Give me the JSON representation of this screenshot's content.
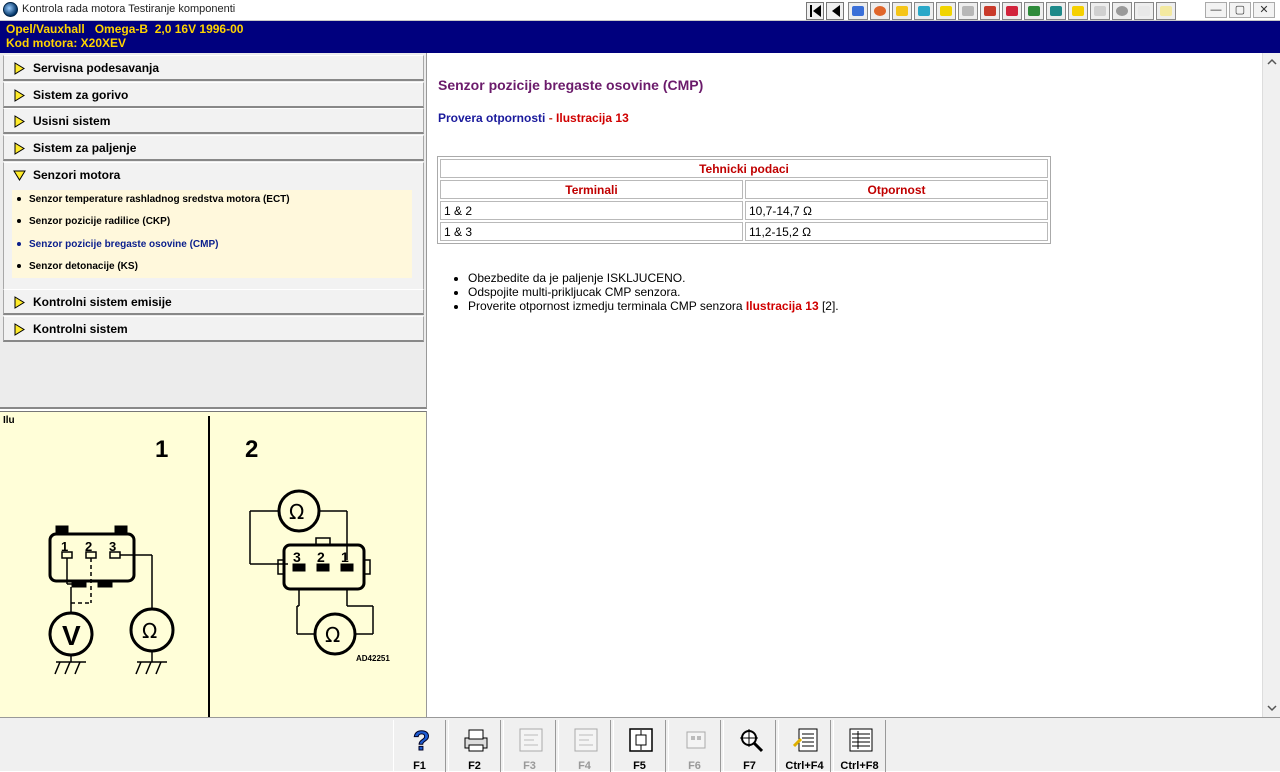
{
  "window": {
    "title": "Kontrola rada motora Testiranje komponenti"
  },
  "window_controls": {
    "minimize": "—",
    "maximize": "▢",
    "close": "✕"
  },
  "toolbar_icons": [
    "graph-icon",
    "globe-icon",
    "wrench-icon",
    "gauge-icon",
    "list-icon",
    "document-icon",
    "car-icon",
    "cards-icon",
    "chip-icon",
    "tools-icon",
    "gear-icon",
    "warning-icon",
    "stop-icon",
    "book-icon"
  ],
  "vehicle": {
    "line1": "Opel/Vauxhall   Omega-B  2,0 16V 1996-00",
    "line2": "Kod motora: X20XEV"
  },
  "nav": {
    "sections": [
      {
        "label": "Servisna podesavanja"
      },
      {
        "label": "Sistem za gorivo"
      },
      {
        "label": "Usisni sistem"
      },
      {
        "label": "Sistem za paljenje"
      },
      {
        "label": "Senzori motora"
      },
      {
        "label": "Kontrolni sistem emisije"
      },
      {
        "label": "Kontrolni sistem"
      }
    ],
    "subitems": [
      {
        "label": "Senzor temperature rashladnog sredstva motora (ECT)"
      },
      {
        "label": "Senzor pozicije radilice (CKP)"
      },
      {
        "label": "Senzor pozicije bregaste osovine (CMP)",
        "active": true
      },
      {
        "label": "Senzor detonacije (KS)"
      }
    ]
  },
  "illustration": {
    "label": "Ilu",
    "panel1_number": "1",
    "panel2_number": "2",
    "pins_panel1": [
      "1",
      "2",
      "3"
    ],
    "pins_panel2": [
      "3",
      "2",
      "1"
    ],
    "meter_v": "V",
    "meter_ohm": "Ω",
    "code": "AD42251"
  },
  "content": {
    "title": "Senzor pozicije bregaste osovine (CMP)",
    "test_name": "Provera otpornosti",
    "test_sep": " - ",
    "test_link": "Ilustracija 13",
    "table": {
      "caption": "Tehnicki podaci",
      "headers": [
        "Terminali",
        "Otpornost"
      ],
      "rows": [
        [
          "1 & 2",
          "10,7-14,7 Ω"
        ],
        [
          "1 & 3",
          "11,2-15,2 Ω"
        ]
      ]
    },
    "instructions": [
      {
        "text": "Obezbedite da je paljenje ISKLJUCENO."
      },
      {
        "text": "Odspojite multi-prikljucak CMP senzora."
      },
      {
        "text": "Proverite otpornost izmedju terminala CMP senzora ",
        "link": "Ilustracija 13",
        "suffix": " [2]."
      }
    ]
  },
  "fkeys": [
    {
      "label": "F1",
      "icon": "help-icon",
      "enabled": true
    },
    {
      "label": "F2",
      "icon": "printer-icon",
      "enabled": true
    },
    {
      "label": "F3",
      "icon": "diagram-icon",
      "enabled": false
    },
    {
      "label": "F4",
      "icon": "diagram-icon",
      "enabled": false
    },
    {
      "label": "F5",
      "icon": "component-icon",
      "enabled": true
    },
    {
      "label": "F6",
      "icon": "connector-icon",
      "enabled": false
    },
    {
      "label": "F7",
      "icon": "zoom-icon",
      "enabled": true
    },
    {
      "label": "Ctrl+F4",
      "icon": "notes-icon",
      "enabled": true
    },
    {
      "label": "Ctrl+F8",
      "icon": "list-icon",
      "enabled": true
    }
  ]
}
